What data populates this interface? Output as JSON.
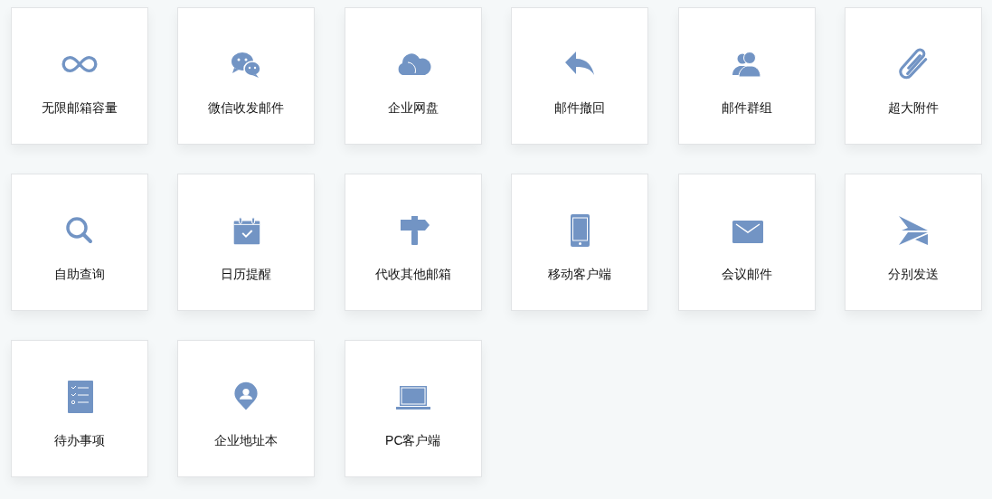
{
  "features": [
    {
      "kind": "infinity",
      "label": "无限邮箱容量"
    },
    {
      "kind": "chat",
      "label": "微信收发邮件"
    },
    {
      "kind": "cloud",
      "label": "企业网盘"
    },
    {
      "kind": "reply",
      "label": "邮件撤回"
    },
    {
      "kind": "group",
      "label": "邮件群组"
    },
    {
      "kind": "paperclip",
      "label": "超大附件"
    },
    {
      "kind": "search",
      "label": "自助查询"
    },
    {
      "kind": "calendar",
      "label": "日历提醒"
    },
    {
      "kind": "signpost",
      "label": "代收其他邮箱"
    },
    {
      "kind": "phone",
      "label": "移动客户端"
    },
    {
      "kind": "envelope",
      "label": "会议邮件"
    },
    {
      "kind": "send",
      "label": "分别发送"
    },
    {
      "kind": "checklist",
      "label": "待办事项"
    },
    {
      "kind": "pin",
      "label": "企业地址本"
    },
    {
      "kind": "laptop",
      "label": "PC客户端"
    }
  ]
}
